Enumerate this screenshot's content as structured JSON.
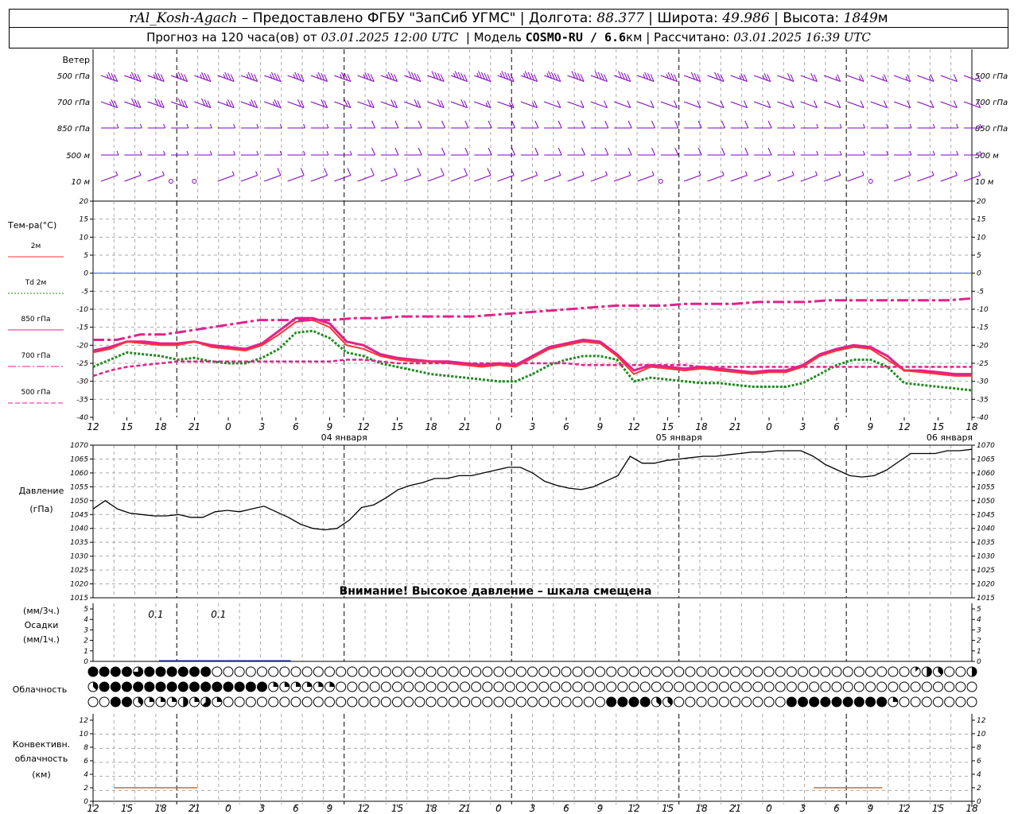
{
  "header": {
    "station": "rAl_Kosh-Agach",
    "provided_by": "Предоставлено ФГБУ \"ЗапСиб УГМС\"",
    "lon_label": "Долгота:",
    "lon": "88.377",
    "lat_label": "Широта:",
    "lat": "49.986",
    "alt_label": "Высота:",
    "alt": "1849",
    "alt_unit": "м",
    "forecast_label": "Прогноз на 120 часа(ов) от",
    "forecast_time": "03.01.2025 12:00 UTC",
    "model_label": "Модель",
    "model": "COSMO-RU / 6.6",
    "model_unit": "км",
    "calc_label": "Рассчитано:",
    "calc_time": "03.01.2025 16:39 UTC"
  },
  "colors": {
    "t2m": "#ff3333",
    "td2m": "#228b22",
    "t850": "#e0228c",
    "t700": "#e0228c",
    "t500": "#e0228c",
    "wind": "#8000c0",
    "pressure": "#000000",
    "precip": "#1030c0",
    "conv": "#d2691e",
    "zero": "#3050ff"
  },
  "wind_panel": {
    "title": "Ветер",
    "levels": [
      "500 гПа",
      "700 гПа",
      "850 гПа",
      "500 м",
      "10 м"
    ]
  },
  "temp_panel": {
    "title": "Тем-ра(°С)",
    "legend": [
      {
        "label": "2м",
        "style": "solid",
        "color": "#ff3333"
      },
      {
        "label": "Td  2м",
        "style": "dotted",
        "color": "#228b22"
      },
      {
        "label": "850 гПа",
        "style": "solid",
        "color": "#e0228c"
      },
      {
        "label": "700 гПа",
        "style": "dashdot",
        "color": "#e0228c"
      },
      {
        "label": "500 гПа",
        "style": "dashed",
        "color": "#e0228c"
      }
    ],
    "yticks": [
      "20",
      "15",
      "10",
      "5",
      "0",
      "-5",
      "-10",
      "-15",
      "-20",
      "-25",
      "-30",
      "-35",
      "-40"
    ]
  },
  "xaxis": {
    "hour_labels": [
      "12",
      "15",
      "18",
      "21",
      "0",
      "3",
      "6",
      "9",
      "12",
      "15",
      "18",
      "21",
      "0",
      "3",
      "6",
      "9",
      "12",
      "15",
      "18",
      "21",
      "0",
      "3",
      "6",
      "9",
      "12",
      "15",
      "18"
    ],
    "date_labels": [
      "04 января",
      "05 января",
      "06 января"
    ]
  },
  "pressure_panel": {
    "title": "Давление",
    "unit": "(гПа)",
    "yticks": [
      "1070",
      "1065",
      "1060",
      "1055",
      "1050",
      "1045",
      "1040",
      "1035",
      "1030",
      "1025",
      "1020",
      "1015"
    ],
    "warning": "Внимание! Высокое давление – шкала смещена"
  },
  "precip_panel": {
    "unit3": "(мм/3ч.)",
    "title": "Осадки",
    "unit1": "(мм/1ч.)",
    "yticks": [
      "5",
      "4",
      "3",
      "2",
      "1",
      "0"
    ],
    "labels": [
      {
        "h": 3,
        "text": "0.1"
      },
      {
        "h": 6,
        "text": "0.1"
      }
    ]
  },
  "cloud_panel": {
    "title": "Облачность"
  },
  "conv_panel": {
    "line1": "Конвективн.",
    "line2": "облачность",
    "line3": "(км)",
    "yticks": [
      "12",
      "10",
      "8",
      "6",
      "4",
      "2",
      "0"
    ]
  },
  "chart_data": [
    {
      "type": "line",
      "title": "Тем-ра(°С)",
      "ylim": [
        -40,
        20
      ],
      "x_hours_from_start": "0..78 step 3",
      "series": [
        {
          "name": "2м",
          "values": [
            -22,
            -21,
            -19,
            -19.5,
            -20,
            -20,
            -19,
            -20.5,
            -21,
            -21.5,
            -20,
            -17,
            -13.5,
            -13,
            -15,
            -20,
            -21,
            -23,
            -24,
            -24.5,
            -24.5,
            -25,
            -25.5,
            -26,
            -25.5,
            -26,
            -23.5,
            -21,
            -20,
            -19,
            -19.5,
            -23,
            -28,
            -26,
            -26.5,
            -27,
            -26.5,
            -27,
            -27.5,
            -28,
            -27.5,
            -27.5,
            -26,
            -23,
            -21.5,
            -20.5,
            -21,
            -24,
            -27,
            -27.5,
            -28,
            -28.5,
            -28.5
          ]
        },
        {
          "name": "Td  2м",
          "values": [
            -26,
            -24,
            -22,
            -22.5,
            -23,
            -24,
            -23.5,
            -24.5,
            -25,
            -25,
            -23.5,
            -21,
            -16.5,
            -16,
            -18,
            -22,
            -23,
            -25,
            -26,
            -27,
            -28,
            -28.5,
            -29,
            -29.5,
            -30,
            -30,
            -28,
            -25.5,
            -24,
            -23,
            -23,
            -24,
            -30,
            -29,
            -29.5,
            -30,
            -30.5,
            -30.5,
            -31,
            -31.5,
            -31.5,
            -31.5,
            -30.5,
            -28,
            -25.5,
            -24,
            -24,
            -26,
            -30.5,
            -31,
            -31.5,
            -32,
            -32.5
          ]
        },
        {
          "name": "850 гПа",
          "values": [
            -21.5,
            -20.5,
            -19,
            -19,
            -19.5,
            -19.5,
            -19,
            -20,
            -20.5,
            -21,
            -19.5,
            -16,
            -12.5,
            -12.5,
            -14,
            -19,
            -20,
            -22.5,
            -23.5,
            -24,
            -24.5,
            -24.5,
            -25,
            -25.5,
            -25,
            -25.5,
            -23,
            -20.5,
            -19.5,
            -18.5,
            -19,
            -22.5,
            -27,
            -25.5,
            -26,
            -26.5,
            -26,
            -26.5,
            -27,
            -27.5,
            -27,
            -27,
            -25.5,
            -22.5,
            -21,
            -20,
            -20.5,
            -23,
            -27,
            -27,
            -27.5,
            -28,
            -28
          ]
        },
        {
          "name": "700 гПа",
          "values": [
            -18.5,
            -18.5,
            -17,
            -17,
            -16,
            -15,
            -14,
            -13,
            -13,
            -13,
            -13,
            -12.5,
            -12.5,
            -12,
            -12,
            -12,
            -12,
            -11.5,
            -11,
            -10.5,
            -10,
            -9.5,
            -9,
            -9,
            -9,
            -8.5,
            -8.5,
            -8.5,
            -8,
            -8,
            -8,
            -7.5,
            -7.5,
            -7.5,
            -7.5,
            -7.5,
            -7.5,
            -7
          ]
        },
        {
          "name": "500 гПа",
          "values": [
            -28.5,
            -27,
            -26,
            -25.5,
            -25,
            -24.5,
            -24.5,
            -24.5,
            -24.5,
            -24.5,
            -24.5,
            -24.5,
            -24.5,
            -24.5,
            -24.5,
            -24,
            -24,
            -24.5,
            -25,
            -25,
            -25,
            -25,
            -25,
            -25,
            -25,
            -25,
            -25,
            -25,
            -25,
            -25.5,
            -25.5,
            -25.5,
            -25.5,
            -25.5,
            -25.5,
            -25.5,
            -26,
            -26,
            -26,
            -26,
            -26,
            -26,
            -26,
            -26,
            -26,
            -26,
            -26,
            -26,
            -26,
            -26,
            -26,
            -26,
            -26
          ]
        }
      ]
    },
    {
      "type": "line",
      "title": "Давление",
      "ylim": [
        1015,
        1070
      ],
      "series": [
        {
          "name": "Давление",
          "values": [
            1047,
            1050,
            1047,
            1045.5,
            1045,
            1044.5,
            1044.5,
            1045,
            1044,
            1044,
            1046,
            1046.5,
            1046,
            1047,
            1048,
            1046,
            1044,
            1041.5,
            1040,
            1039.5,
            1040,
            1043,
            1047.5,
            1048.5,
            1051,
            1054,
            1055.5,
            1056.5,
            1058,
            1058,
            1059,
            1059,
            1060,
            1061,
            1062,
            1062,
            1060,
            1057,
            1055.5,
            1054.5,
            1054,
            1055,
            1057,
            1059,
            1066,
            1063.5,
            1063.5,
            1064.5,
            1065,
            1065.5,
            1066,
            1066,
            1066.5,
            1067,
            1067.5,
            1067.5,
            1068,
            1068,
            1068,
            1066,
            1063,
            1061,
            1059,
            1058.5,
            1059,
            1061,
            1064,
            1067,
            1067,
            1067,
            1068,
            1068,
            1068.5
          ]
        }
      ]
    },
    {
      "type": "bar",
      "title": "Осадки",
      "ylim": [
        0,
        5
      ],
      "series": [
        {
          "name": "Осадки",
          "values": [
            0,
            0,
            0,
            0.1,
            0.1,
            0.1,
            0.1,
            0.1,
            0.1
          ]
        }
      ]
    },
    {
      "type": "line",
      "title": "Конвективн. облачность",
      "ylim": [
        0,
        13
      ],
      "segments": [
        {
          "from_h": 6,
          "to_h": 18,
          "value": 2
        },
        {
          "from_h": 126,
          "to_h": 138,
          "value": 2
        }
      ]
    }
  ],
  "clouds": {
    "rows": [
      {
        "name": "верхний",
        "codes": "88886888888000000000000000000000000000000000000000000000000000000000000001430041445400050000000000000000000000000000000000000000000001868"
      },
      {
        "name": "средний",
        "codes": "38888888888888882222220000000000000000000000000000000000000000000000000000000000000000000000000000000000000000000000000000000000000000000"
      },
      {
        "name": "нижний",
        "codes": "00883222425200000000000000000000000000000000008888330000000000888888888200000000000000000082000000008888888888800000020000000000000000000000000000"
      }
    ]
  },
  "wind": {
    "rows": [
      {
        "level": "500 гПа",
        "dir": 290,
        "speed": [
          35,
          35,
          35,
          35,
          35,
          35,
          35,
          35,
          35,
          35,
          35,
          35,
          35,
          40,
          40,
          45,
          45,
          45,
          45,
          45,
          40,
          40,
          40,
          35,
          35,
          30,
          30,
          25,
          25,
          20,
          20,
          15,
          15,
          15,
          15,
          15,
          10,
          10
        ]
      },
      {
        "level": "700 гПа",
        "dir": 290,
        "speed": [
          25,
          30,
          30,
          30,
          30,
          25,
          25,
          25,
          20,
          20,
          20,
          20,
          20,
          20,
          20,
          20,
          15,
          15,
          15,
          10,
          10,
          10,
          10,
          10,
          10,
          10,
          10,
          10,
          10,
          10,
          10,
          10,
          10,
          10,
          10,
          10,
          10,
          10
        ]
      },
      {
        "level": "850 гПа",
        "dir": 270,
        "speed": [
          5,
          5,
          5,
          5,
          5,
          5,
          5,
          5,
          5,
          5,
          5,
          10,
          10,
          10,
          10,
          10,
          10,
          10,
          10,
          10,
          10,
          10,
          10,
          10,
          10,
          10,
          10,
          10,
          10,
          5,
          5,
          5,
          5,
          5,
          5,
          5,
          5,
          5
        ]
      },
      {
        "level": "500 м",
        "dir": 270,
        "speed": [
          5,
          5,
          5,
          5,
          5,
          5,
          5,
          5,
          5,
          5,
          5,
          10,
          10,
          10,
          10,
          10,
          10,
          10,
          10,
          10,
          10,
          10,
          10,
          10,
          10,
          10,
          10,
          10,
          10,
          5,
          5,
          5,
          5,
          5,
          5,
          5,
          5,
          5
        ]
      },
      {
        "level": "10 м",
        "dir": 250,
        "speed": [
          5,
          5,
          5,
          0,
          0,
          5,
          5,
          10,
          10,
          10,
          10,
          10,
          10,
          10,
          10,
          10,
          10,
          5,
          5,
          5,
          5,
          5,
          5,
          5,
          0,
          5,
          5,
          5,
          5,
          5,
          5,
          5,
          5,
          0,
          5,
          5,
          5,
          5
        ]
      }
    ]
  }
}
